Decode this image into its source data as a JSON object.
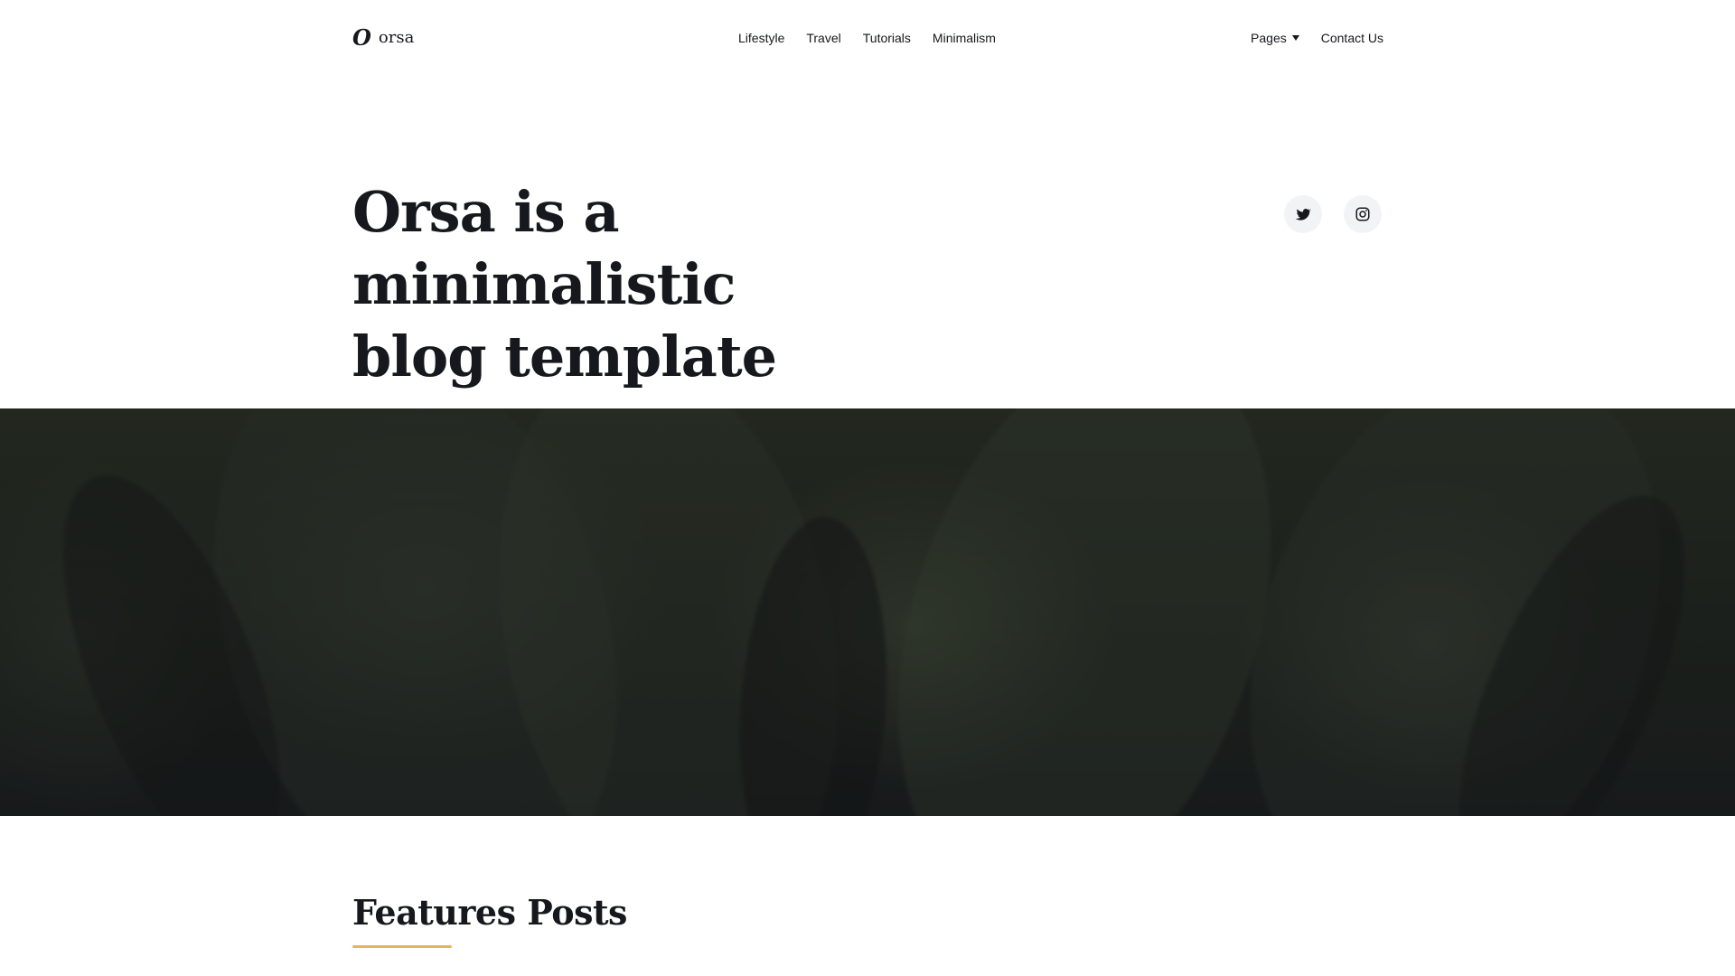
{
  "header": {
    "logo_mark": "O",
    "logo_text": "orsa",
    "nav": [
      {
        "label": "Lifestyle"
      },
      {
        "label": "Travel"
      },
      {
        "label": "Tutorials"
      },
      {
        "label": "Minimalism"
      }
    ],
    "pages_label": "Pages",
    "contact_label": "Contact Us"
  },
  "hero": {
    "title_line1": "Orsa is a minimalistic",
    "title_line2": "blog template"
  },
  "social": {
    "icons": [
      "twitter-icon",
      "instagram-icon"
    ]
  },
  "features": {
    "title": "Features Posts",
    "accent_color": "#e8b15f"
  }
}
